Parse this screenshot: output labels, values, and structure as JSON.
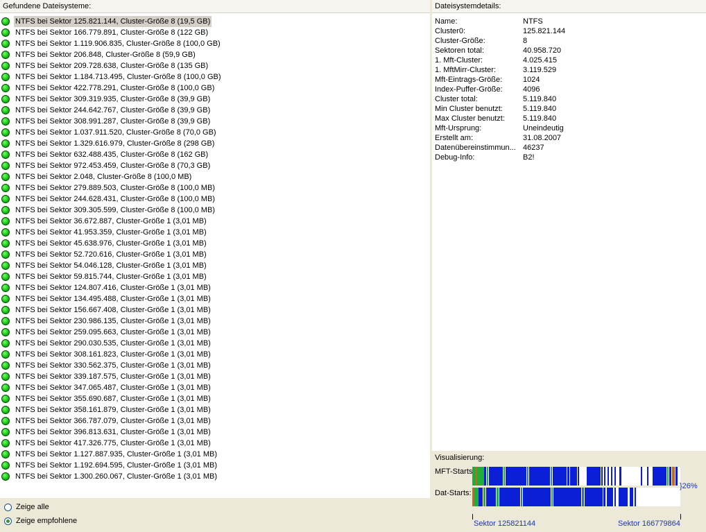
{
  "left_panel": {
    "title": "Gefundene Dateisysteme:",
    "filesystems": [
      {
        "label": "NTFS bei Sektor 125.821.144, Cluster-Größe 8 (19,5 GB)",
        "selected": true
      },
      {
        "label": "NTFS bei Sektor 166.779.891, Cluster-Größe 8 (122 GB)"
      },
      {
        "label": "NTFS bei Sektor 1.119.906.835, Cluster-Größe 8 (100,0 GB)"
      },
      {
        "label": "NTFS bei Sektor 206.848, Cluster-Größe 8 (59,9 GB)"
      },
      {
        "label": "NTFS bei Sektor 209.728.638, Cluster-Größe 8 (135 GB)"
      },
      {
        "label": "NTFS bei Sektor 1.184.713.495, Cluster-Größe 8 (100,0 GB)"
      },
      {
        "label": "NTFS bei Sektor 422.778.291, Cluster-Größe 8 (100,0 GB)"
      },
      {
        "label": "NTFS bei Sektor 309.319.935, Cluster-Größe 8 (39,9 GB)"
      },
      {
        "label": "NTFS bei Sektor 244.642.767, Cluster-Größe 8 (39,9 GB)"
      },
      {
        "label": "NTFS bei Sektor 308.991.287, Cluster-Größe 8 (39,9 GB)"
      },
      {
        "label": "NTFS bei Sektor 1.037.911.520, Cluster-Größe 8 (70,0 GB)"
      },
      {
        "label": "NTFS bei Sektor 1.329.616.979, Cluster-Größe 8 (298 GB)"
      },
      {
        "label": "NTFS bei Sektor 632.488.435, Cluster-Größe 8 (162 GB)"
      },
      {
        "label": "NTFS bei Sektor 972.453.459, Cluster-Größe 8 (70,3 GB)"
      },
      {
        "label": "NTFS bei Sektor 2.048, Cluster-Größe 8 (100,0 MB)"
      },
      {
        "label": "NTFS bei Sektor 279.889.503, Cluster-Größe 8 (100,0 MB)"
      },
      {
        "label": "NTFS bei Sektor 244.628.431, Cluster-Größe 8 (100,0 MB)"
      },
      {
        "label": "NTFS bei Sektor 309.305.599, Cluster-Größe 8 (100,0 MB)"
      },
      {
        "label": "NTFS bei Sektor 36.672.887, Cluster-Größe 1 (3,01 MB)"
      },
      {
        "label": "NTFS bei Sektor 41.953.359, Cluster-Größe 1 (3,01 MB)"
      },
      {
        "label": "NTFS bei Sektor 45.638.976, Cluster-Größe 1 (3,01 MB)"
      },
      {
        "label": "NTFS bei Sektor 52.720.616, Cluster-Größe 1 (3,01 MB)"
      },
      {
        "label": "NTFS bei Sektor 54.046.128, Cluster-Größe 1 (3,01 MB)"
      },
      {
        "label": "NTFS bei Sektor 59.815.744, Cluster-Größe 1 (3,01 MB)"
      },
      {
        "label": "NTFS bei Sektor 124.807.416, Cluster-Größe 1 (3,01 MB)"
      },
      {
        "label": "NTFS bei Sektor 134.495.488, Cluster-Größe 1 (3,01 MB)"
      },
      {
        "label": "NTFS bei Sektor 156.667.408, Cluster-Größe 1 (3,01 MB)"
      },
      {
        "label": "NTFS bei Sektor 230.986.135, Cluster-Größe 1 (3,01 MB)"
      },
      {
        "label": "NTFS bei Sektor 259.095.663, Cluster-Größe 1 (3,01 MB)"
      },
      {
        "label": "NTFS bei Sektor 290.030.535, Cluster-Größe 1 (3,01 MB)"
      },
      {
        "label": "NTFS bei Sektor 308.161.823, Cluster-Größe 1 (3,01 MB)"
      },
      {
        "label": "NTFS bei Sektor 330.562.375, Cluster-Größe 1 (3,01 MB)"
      },
      {
        "label": "NTFS bei Sektor 339.187.575, Cluster-Größe 1 (3,01 MB)"
      },
      {
        "label": "NTFS bei Sektor 347.065.487, Cluster-Größe 1 (3,01 MB)"
      },
      {
        "label": "NTFS bei Sektor 355.690.687, Cluster-Größe 1 (3,01 MB)"
      },
      {
        "label": "NTFS bei Sektor 358.161.879, Cluster-Größe 1 (3,01 MB)"
      },
      {
        "label": "NTFS bei Sektor 366.787.079, Cluster-Größe 1 (3,01 MB)"
      },
      {
        "label": "NTFS bei Sektor 396.813.631, Cluster-Größe 1 (3,01 MB)"
      },
      {
        "label": "NTFS bei Sektor 417.326.775, Cluster-Größe 1 (3,01 MB)"
      },
      {
        "label": "NTFS bei Sektor 1.127.887.935, Cluster-Größe 1 (3,01 MB)"
      },
      {
        "label": "NTFS bei Sektor 1.192.694.595, Cluster-Größe 1 (3,01 MB)"
      },
      {
        "label": "NTFS bei Sektor 1.300.260.067, Cluster-Größe 1 (3,01 MB)"
      }
    ],
    "status_icon": "green-status-dot-icon",
    "options": {
      "show_all": "Zeige alle",
      "show_recommended": "Zeige empfohlene",
      "selected": "show_recommended"
    }
  },
  "right_panel": {
    "title": "Dateisystemdetails:",
    "details": [
      {
        "label": "Name:",
        "value": "NTFS"
      },
      {
        "label": "Cluster0:",
        "value": "125.821.144"
      },
      {
        "label": "Cluster-Größe:",
        "value": "8"
      },
      {
        "label": "Sektoren total:",
        "value": "40.958.720"
      },
      {
        "label": "1. Mft-Cluster:",
        "value": "4.025.415"
      },
      {
        "label": "1. MftMirr-Cluster:",
        "value": "3.119.529"
      },
      {
        "label": "Mft-Eintrags-Größe:",
        "value": "1024"
      },
      {
        "label": "Index-Puffer-Größe:",
        "value": "4096"
      },
      {
        "label": "Cluster total:",
        "value": "5.119.840"
      },
      {
        "label": "Min Cluster benutzt:",
        "value": "5.119.840"
      },
      {
        "label": "Max Cluster benutzt:",
        "value": "5.119.840"
      },
      {
        "label": "Mft-Ursprung:",
        "value": "Uneindeutig"
      },
      {
        "label": "Erstellt am:",
        "value": "31.08.2007"
      },
      {
        "label": "Datenübereinstimmun...",
        "value": "46237"
      },
      {
        "label": "Debug-Info:",
        "value": "B2!"
      }
    ],
    "visualization": {
      "title": "Visualisierung:",
      "mft_label": "MFT-Starts:",
      "dat_label": "Dat-Starts:",
      "percent": "}26%",
      "sector_start": "Sektor 125821144",
      "sector_end": "Sektor 166779864",
      "colors": {
        "primary": "#0a1fd6",
        "accent_green": "#1fae3a",
        "accent_orange": "#c8641e",
        "link_text": "#1a33c4"
      }
    }
  }
}
